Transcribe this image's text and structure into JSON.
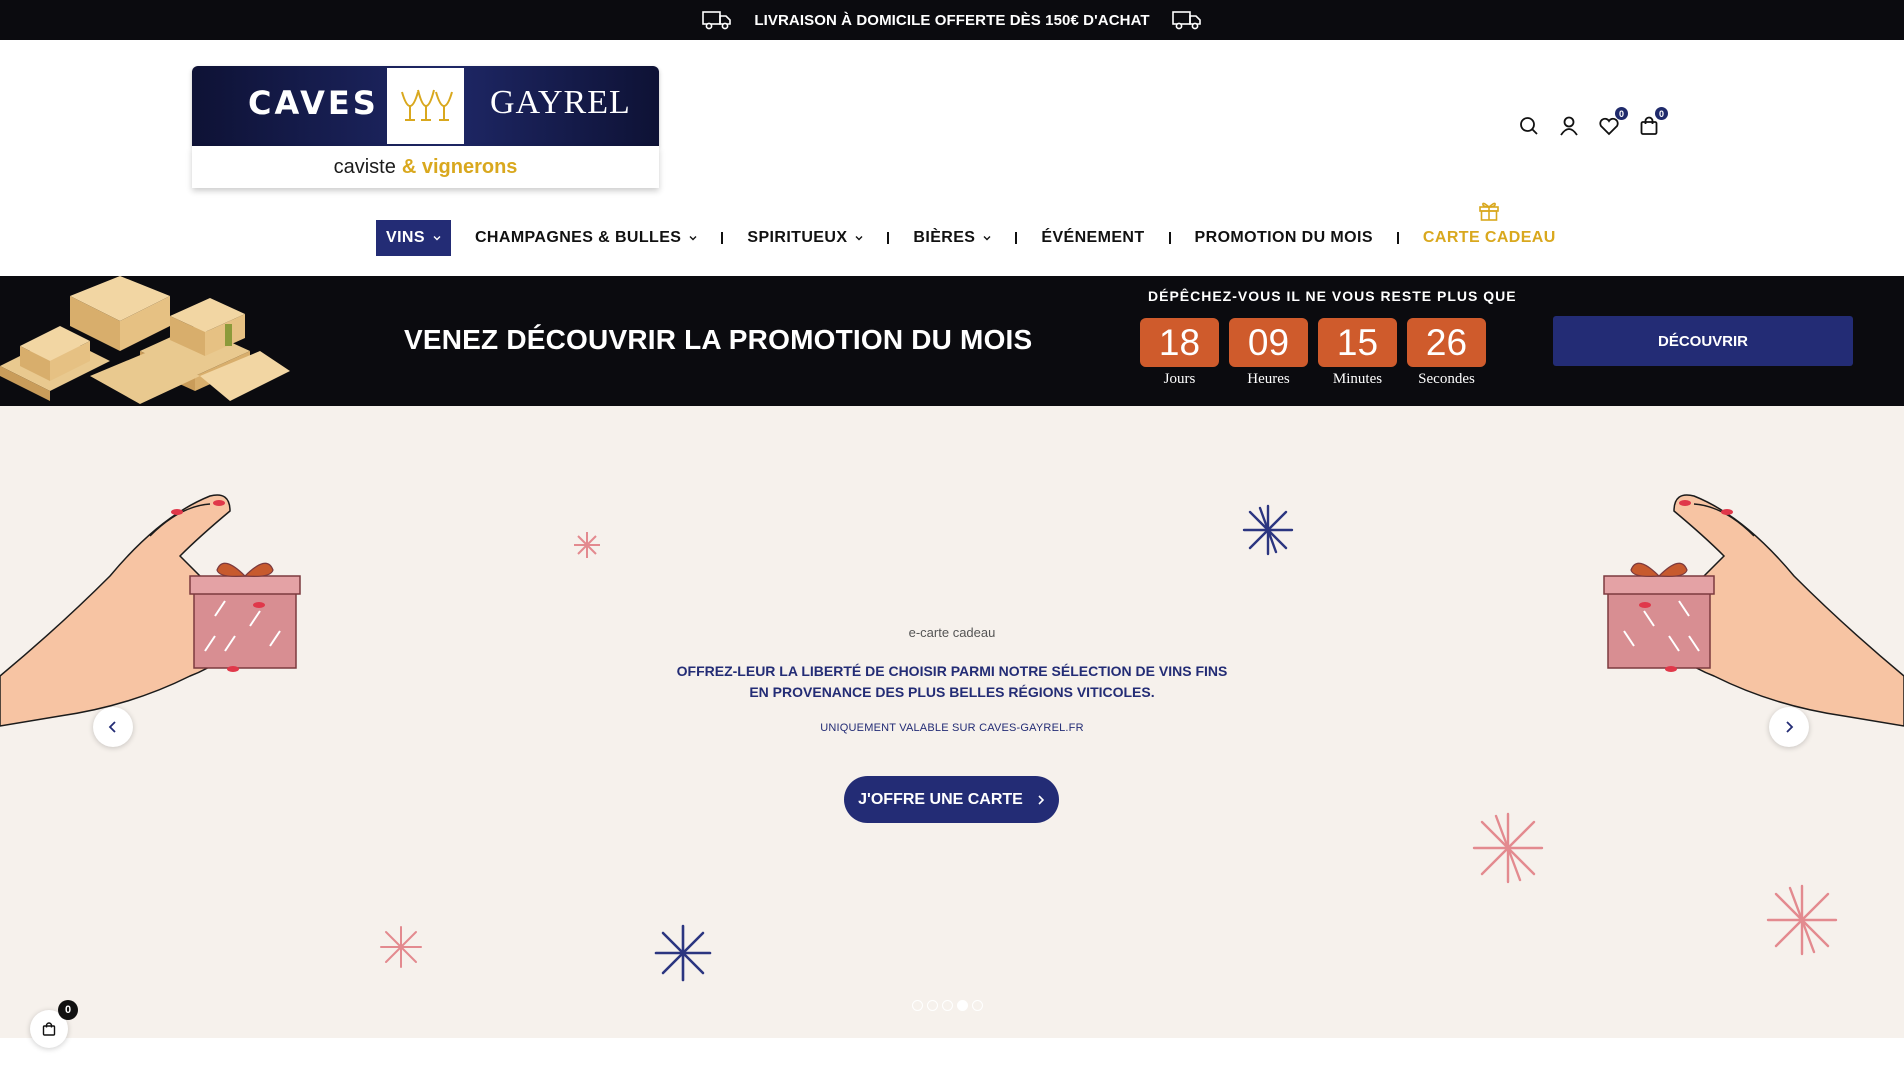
{
  "topbar": {
    "text": "LIVRAISON À DOMICILE OFFERTE DÈS 150€ D'ACHAT",
    "icons": [
      "truck-icon",
      "truck-icon"
    ]
  },
  "brand": {
    "word_left": "CAVES",
    "word_right": "GAYREL",
    "tagline_part1": "caviste",
    "tagline_part2": "& vignerons",
    "colors": {
      "navy": "#1e2766",
      "gold": "#d9a81e"
    }
  },
  "header_icons": {
    "search": "search-icon",
    "account": "user-icon",
    "wishlist_count": "0",
    "cart_count": "0"
  },
  "nav": {
    "items": [
      {
        "label": "VINS",
        "dropdown": true,
        "active": true
      },
      {
        "label": "CHAMPAGNES & BULLES",
        "dropdown": true
      },
      {
        "label": "SPIRITUEUX",
        "dropdown": true
      },
      {
        "label": "BIÈRES",
        "dropdown": true
      },
      {
        "label": "ÉVÉNEMENT",
        "dropdown": false
      },
      {
        "label": "PROMOTION DU MOIS",
        "dropdown": false
      },
      {
        "label": "CARTE CADEAU",
        "dropdown": false,
        "icon": "gift-icon",
        "color": "#d9a81e"
      }
    ]
  },
  "promo": {
    "title": "VENEZ DÉCOUVRIR LA PROMOTION DU MOIS",
    "hurry": "DÉPÊCHEZ-VOUS IL NE VOUS RESTE PLUS QUE",
    "countdown": [
      {
        "value": "18",
        "label": "Jours"
      },
      {
        "value": "09",
        "label": "Heures"
      },
      {
        "value": "15",
        "label": "Minutes"
      },
      {
        "value": "26",
        "label": "Secondes"
      }
    ],
    "button": "DÉCOUVRIR",
    "colors": {
      "countdown_bg": "#cf5b2c",
      "button_bg": "#232c75"
    }
  },
  "hero": {
    "kicker": "e-carte cadeau",
    "line1": "OFFREZ-LEUR LA LIBERTÉ DE CHOISIR PARMI NOTRE SÉLECTION DE VINS FINS",
    "line2": "EN PROVENANCE DES PLUS BELLES RÉGIONS VITICOLES.",
    "small": "UNIQUEMENT VALABLE SUR CAVES-GAYREL.FR",
    "button": "J'OFFRE UNE CARTE",
    "slide_count": 5,
    "active_slide": 4,
    "background": "#f6f1ec"
  },
  "floating_cart": {
    "count": "0"
  }
}
